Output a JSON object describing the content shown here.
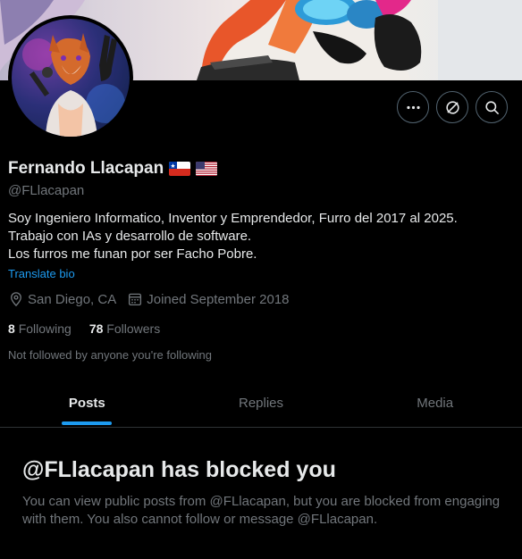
{
  "profile": {
    "name": "Fernando Llacapan",
    "handle": "@FLlacapan",
    "bio_lines": [
      "Soy Ingeniero Informatico, Inventor y Emprendedor, Furro del 2017 al 2025.",
      "Trabajo con IAs y desarrollo de software.",
      "Los furros me funan por ser Facho Pobre."
    ],
    "translate_label": "Translate bio",
    "location": "San Diego, CA",
    "joined": "Joined September 2018",
    "following_count": "8",
    "following_label": "Following",
    "followers_count": "78",
    "followers_label": "Followers",
    "not_followed_text": "Not followed by anyone you're following",
    "flags": [
      "chile-flag-icon",
      "usa-flag-icon"
    ]
  },
  "actions": {
    "more_icon": "more-icon",
    "grok_icon": "grok-icon",
    "search_icon": "search-icon"
  },
  "tabs": [
    {
      "label": "Posts",
      "active": true
    },
    {
      "label": "Replies",
      "active": false
    },
    {
      "label": "Media",
      "active": false
    }
  ],
  "blocked": {
    "title": "@FLlacapan has blocked you",
    "message": "You can view public posts from @FLlacapan, but you are blocked from engaging with them. You also cannot follow or message @FLlacapan."
  },
  "colors": {
    "background": "#000000",
    "text_primary": "#e7e9ea",
    "text_secondary": "#71767b",
    "accent": "#1d9bf0",
    "border": "#2f3336"
  }
}
